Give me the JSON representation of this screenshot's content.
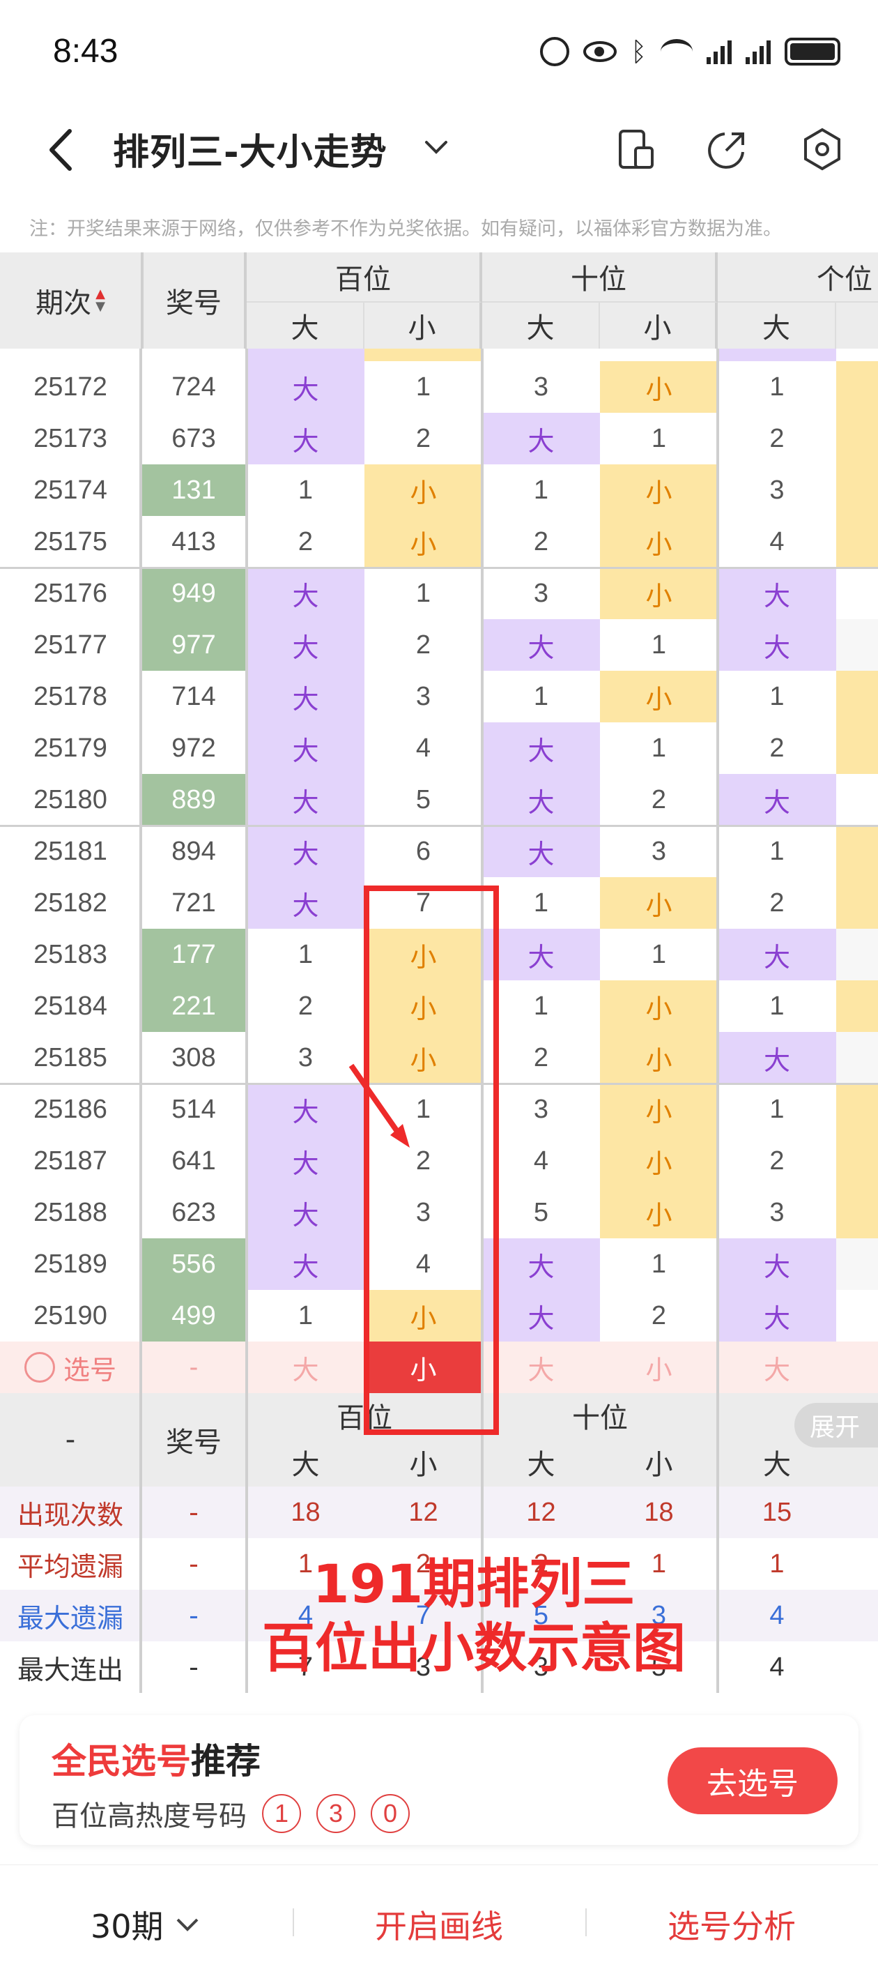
{
  "status": {
    "time": "8:43"
  },
  "header": {
    "title": "排列三-大小走势"
  },
  "note": "注：开奖结果来源于网络，仅供参考不作为兑奖依据。如有疑问，以福体彩官方数据为准。",
  "table": {
    "col_issue": "期次",
    "col_number": "奖号",
    "groups": [
      "百位",
      "十位",
      "个位"
    ],
    "sub": [
      "大",
      "小"
    ],
    "rows": [
      {
        "issue": "25172",
        "num": "724",
        "hot": false,
        "h": [
          "大",
          "1"
        ],
        "t": [
          "3",
          "小"
        ],
        "u": "1"
      },
      {
        "issue": "25173",
        "num": "673",
        "hot": false,
        "h": [
          "大",
          "2"
        ],
        "t": [
          "大",
          "1"
        ],
        "u": "2"
      },
      {
        "issue": "25174",
        "num": "131",
        "hot": true,
        "h": [
          "1",
          "小"
        ],
        "t": [
          "1",
          "小"
        ],
        "u": "3"
      },
      {
        "issue": "25175",
        "num": "413",
        "hot": false,
        "h": [
          "2",
          "小"
        ],
        "t": [
          "2",
          "小"
        ],
        "u": "4"
      },
      {
        "issue": "25176",
        "num": "949",
        "hot": true,
        "h": [
          "大",
          "1"
        ],
        "t": [
          "3",
          "小"
        ],
        "u": "大"
      },
      {
        "issue": "25177",
        "num": "977",
        "hot": true,
        "h": [
          "大",
          "2"
        ],
        "t": [
          "大",
          "1"
        ],
        "u": "大"
      },
      {
        "issue": "25178",
        "num": "714",
        "hot": false,
        "h": [
          "大",
          "3"
        ],
        "t": [
          "1",
          "小"
        ],
        "u": "1"
      },
      {
        "issue": "25179",
        "num": "972",
        "hot": false,
        "h": [
          "大",
          "4"
        ],
        "t": [
          "大",
          "1"
        ],
        "u": "2"
      },
      {
        "issue": "25180",
        "num": "889",
        "hot": true,
        "h": [
          "大",
          "5"
        ],
        "t": [
          "大",
          "2"
        ],
        "u": "大"
      },
      {
        "issue": "25181",
        "num": "894",
        "hot": false,
        "h": [
          "大",
          "6"
        ],
        "t": [
          "大",
          "3"
        ],
        "u": "1"
      },
      {
        "issue": "25182",
        "num": "721",
        "hot": false,
        "h": [
          "大",
          "7"
        ],
        "t": [
          "1",
          "小"
        ],
        "u": "2"
      },
      {
        "issue": "25183",
        "num": "177",
        "hot": true,
        "h": [
          "1",
          "小"
        ],
        "t": [
          "大",
          "1"
        ],
        "u": "大"
      },
      {
        "issue": "25184",
        "num": "221",
        "hot": true,
        "h": [
          "2",
          "小"
        ],
        "t": [
          "1",
          "小"
        ],
        "u": "1"
      },
      {
        "issue": "25185",
        "num": "308",
        "hot": false,
        "h": [
          "3",
          "小"
        ],
        "t": [
          "2",
          "小"
        ],
        "u": "大"
      },
      {
        "issue": "25186",
        "num": "514",
        "hot": false,
        "h": [
          "大",
          "1"
        ],
        "t": [
          "3",
          "小"
        ],
        "u": "1"
      },
      {
        "issue": "25187",
        "num": "641",
        "hot": false,
        "h": [
          "大",
          "2"
        ],
        "t": [
          "4",
          "小"
        ],
        "u": "2"
      },
      {
        "issue": "25188",
        "num": "623",
        "hot": false,
        "h": [
          "大",
          "3"
        ],
        "t": [
          "5",
          "小"
        ],
        "u": "3"
      },
      {
        "issue": "25189",
        "num": "556",
        "hot": true,
        "h": [
          "大",
          "4"
        ],
        "t": [
          "大",
          "1"
        ],
        "u": "大"
      },
      {
        "issue": "25190",
        "num": "499",
        "hot": true,
        "h": [
          "1",
          "小"
        ],
        "t": [
          "大",
          "2"
        ],
        "u": "大"
      }
    ],
    "select_row": {
      "label": "选号",
      "num": "-",
      "cells": [
        "大",
        "小",
        "大",
        "小",
        "大"
      ]
    },
    "expand": "展开",
    "stats": [
      {
        "label": "出现次数",
        "num": "-",
        "vals": [
          "18",
          "12",
          "12",
          "18",
          "15"
        ],
        "color": "#c0392b"
      },
      {
        "label": "平均遗漏",
        "num": "-",
        "vals": [
          "1",
          "2",
          "2",
          "1",
          "1"
        ],
        "color": "#c0392b"
      },
      {
        "label": "最大遗漏",
        "num": "-",
        "vals": [
          "4",
          "7",
          "5",
          "3",
          "4"
        ],
        "color": "#3a6fd8"
      },
      {
        "label": "最大连出",
        "num": "-",
        "vals": [
          "7",
          "3",
          "3",
          "5",
          "4"
        ],
        "color": "#333333"
      }
    ]
  },
  "annotation": {
    "line1": "191期排列三",
    "line2": "百位出小数示意图"
  },
  "recommend": {
    "title_red": "全民选号",
    "title_black": "推荐",
    "subtitle": "百位高热度号码",
    "numbers": [
      "1",
      "3",
      "0"
    ],
    "button": "去选号"
  },
  "tabbar": {
    "period": "30期",
    "draw": "开启画线",
    "analysis": "选号分析"
  },
  "colors": {
    "accent": "#ee3b3b",
    "purple": "#e3d4fb",
    "yellow": "#fde6a4",
    "green": "#a3c39f"
  }
}
